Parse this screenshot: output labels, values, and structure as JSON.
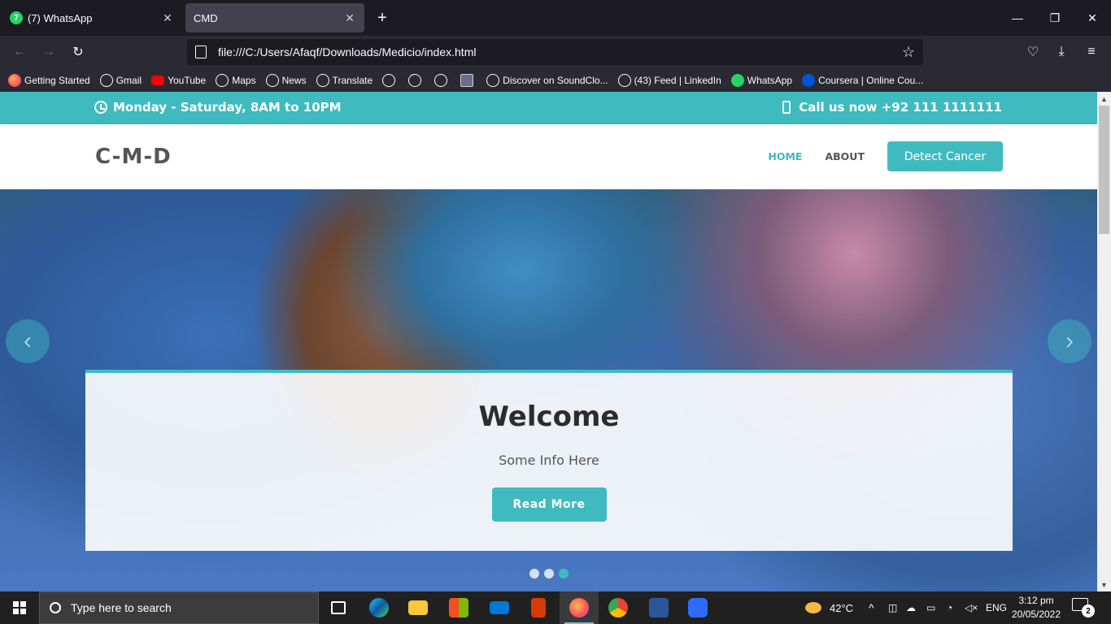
{
  "browser": {
    "tabs": [
      {
        "title": "(7) WhatsApp",
        "active": false
      },
      {
        "title": "CMD",
        "active": true
      }
    ],
    "new_tab": "+",
    "url": "file:///C:/Users/Afaqf/Downloads/Medicio/index.html",
    "bookmarks": [
      {
        "label": "Getting Started",
        "icon": "firefox-icon"
      },
      {
        "label": "Gmail",
        "icon": "globe-icon"
      },
      {
        "label": "YouTube",
        "icon": "youtube-icon"
      },
      {
        "label": "Maps",
        "icon": "globe-icon"
      },
      {
        "label": "News",
        "icon": "globe-icon"
      },
      {
        "label": "Translate",
        "icon": "globe-icon"
      },
      {
        "label": "",
        "icon": "globe-icon"
      },
      {
        "label": "",
        "icon": "globe-icon"
      },
      {
        "label": "",
        "icon": "globe-icon"
      },
      {
        "label": "",
        "icon": "image-icon"
      },
      {
        "label": "Discover on SoundClo...",
        "icon": "globe-icon"
      },
      {
        "label": "(43) Feed | LinkedIn",
        "icon": "globe-icon"
      },
      {
        "label": "WhatsApp",
        "icon": "whatsapp-icon"
      },
      {
        "label": "Coursera | Online Cou...",
        "icon": "coursera-icon"
      }
    ]
  },
  "site": {
    "topbar": {
      "hours": "Monday - Saturday, 8AM to 10PM",
      "phone": "Call us now +92 111 1111111"
    },
    "logo": "C-M-D",
    "menu": {
      "home": "HOME",
      "about": "ABOUT",
      "cta": "Detect Cancer"
    },
    "hero": {
      "title": "Welcome",
      "subtitle": "Some Info Here",
      "button": "Read More",
      "slide_count": 3,
      "active_slide": 3
    }
  },
  "taskbar": {
    "search_placeholder": "Type here to search",
    "weather": "42°C",
    "language": "ENG",
    "time": "3:12 pm",
    "date": "20/05/2022",
    "notifications": "2"
  },
  "colors": {
    "accent": "#3fbbc0",
    "browser_bg": "#1c1b22",
    "toolbar_bg": "#2b2a33",
    "taskbar_bg": "#202020"
  }
}
